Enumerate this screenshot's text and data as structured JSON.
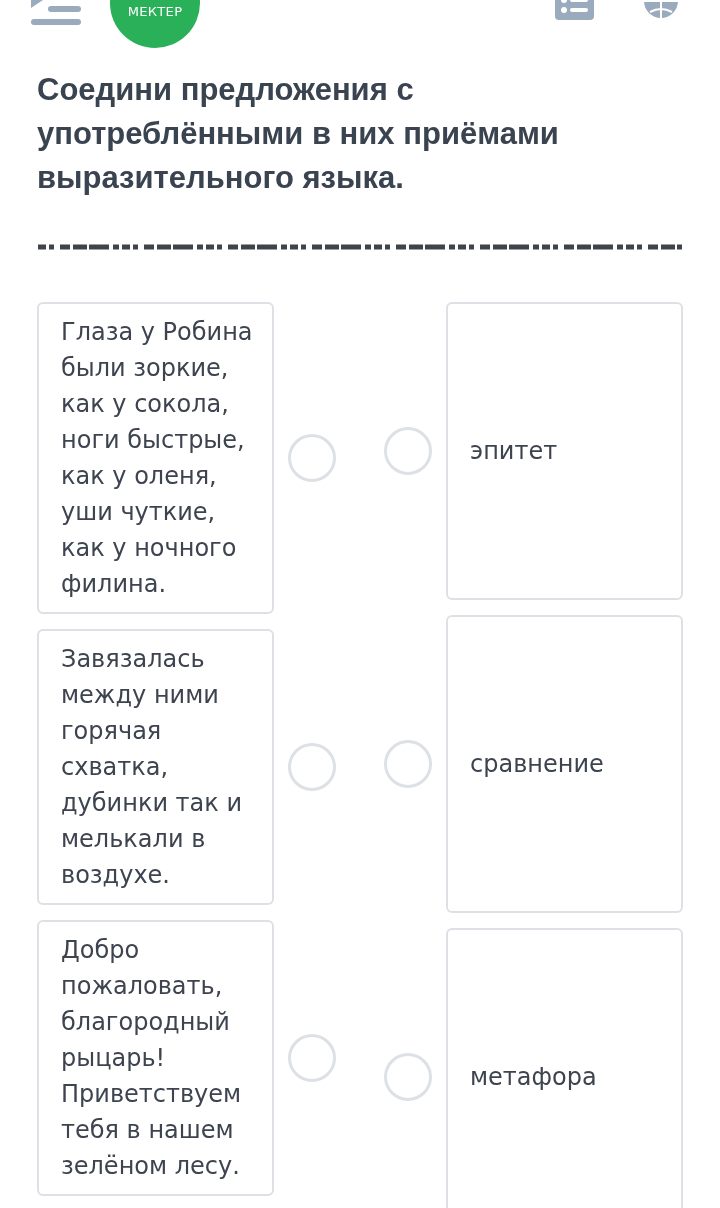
{
  "header": {
    "logo_text": "МЕКТЕР"
  },
  "title": "Соедини предложения с употреблёнными в них приёмами выразительного языка.",
  "sentences": [
    {
      "text": "Глаза у Робина были зоркие, как у сокола, ноги быстрые, как у оленя, уши чуткие, как у ночного филина.",
      "selected": false
    },
    {
      "text": "Завязалась между ними горячая схватка, дубинки так и мелькали в воздухе.",
      "selected": false
    },
    {
      "text": "Добро пожаловать, благородный рыцарь! Приветствуем тебя в нашем зелёном лесу.",
      "selected": false
    }
  ],
  "devices": [
    {
      "text": "эпитет",
      "selected": false
    },
    {
      "text": "сравнение",
      "selected": false
    },
    {
      "text": "метафора",
      "selected": false
    }
  ]
}
